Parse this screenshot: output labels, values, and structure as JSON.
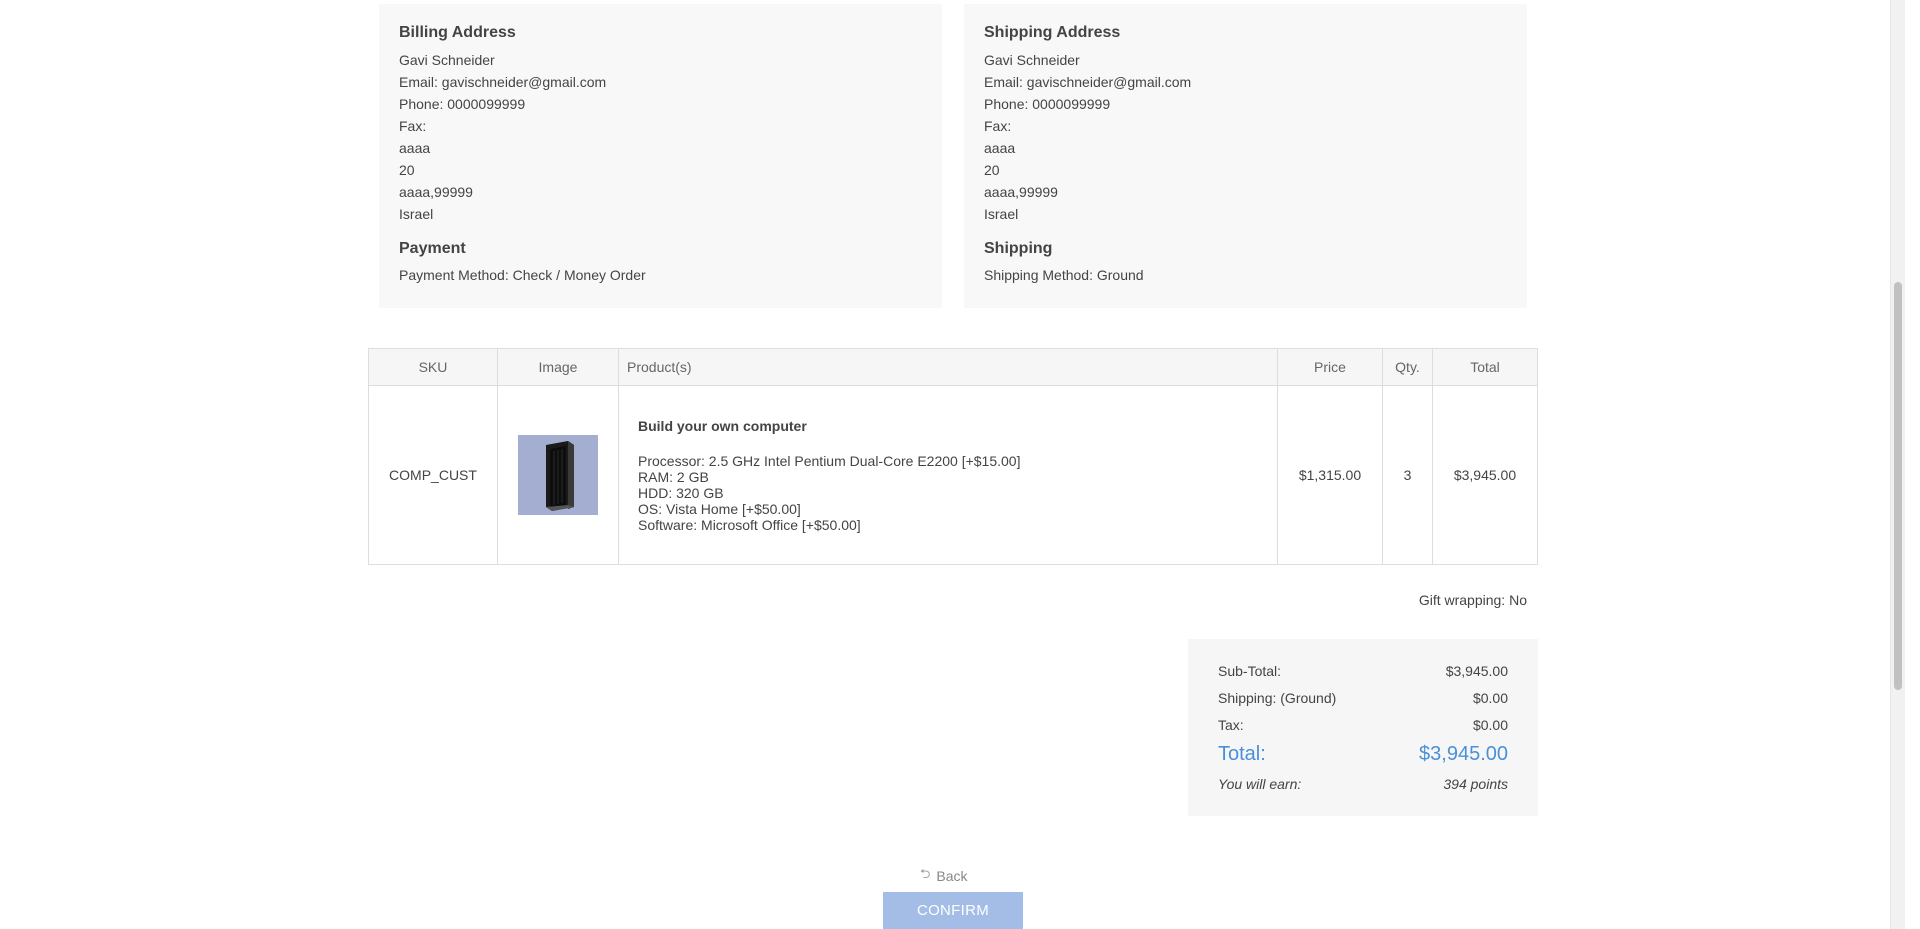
{
  "billing": {
    "title": "Billing Address",
    "name": "Gavi Schneider",
    "email": "Email: gavischneider@gmail.com",
    "phone": "Phone: 0000099999",
    "fax": "Fax:",
    "address1": "aaaa",
    "address2": "20",
    "city_zip": "aaaa,99999",
    "country": "Israel"
  },
  "payment": {
    "title": "Payment",
    "method": "Payment Method: Check / Money Order"
  },
  "shipping_address": {
    "title": "Shipping Address",
    "name": "Gavi Schneider",
    "email": "Email: gavischneider@gmail.com",
    "phone": "Phone: 0000099999",
    "fax": "Fax:",
    "address1": "aaaa",
    "address2": "20",
    "city_zip": "aaaa,99999",
    "country": "Israel"
  },
  "shipping": {
    "title": "Shipping",
    "method": "Shipping Method: Ground"
  },
  "table": {
    "headers": {
      "sku": "SKU",
      "image": "Image",
      "product": "Product(s)",
      "price": "Price",
      "qty": "Qty.",
      "total": "Total"
    },
    "rows": [
      {
        "sku": "COMP_CUST",
        "image_icon": "computer-tower-image",
        "product_name": "Build your own computer",
        "attributes": [
          "Processor: 2.5 GHz Intel Pentium Dual-Core E2200 [+$15.00]",
          "RAM: 2 GB",
          "HDD: 320 GB",
          "OS: Vista Home [+$50.00]",
          "Software: Microsoft Office [+$50.00]"
        ],
        "price": "$1,315.00",
        "qty": "3",
        "total": "$3,945.00"
      }
    ]
  },
  "gift_wrapping": "Gift wrapping: No",
  "totals": {
    "subtotal_label": "Sub-Total:",
    "subtotal_value": "$3,945.00",
    "shipping_label": "Shipping: (Ground)",
    "shipping_value": "$0.00",
    "tax_label": "Tax:",
    "tax_value": "$0.00",
    "total_label": "Total:",
    "total_value": "$3,945.00",
    "earn_label": "You will earn:",
    "earn_value": "394 points",
    "total_color": "#4a90d9"
  },
  "actions": {
    "back_label": "Back",
    "back_icon": "back-arrow-icon",
    "confirm_label": "Confirm",
    "confirm_color": "#a3bde6"
  }
}
